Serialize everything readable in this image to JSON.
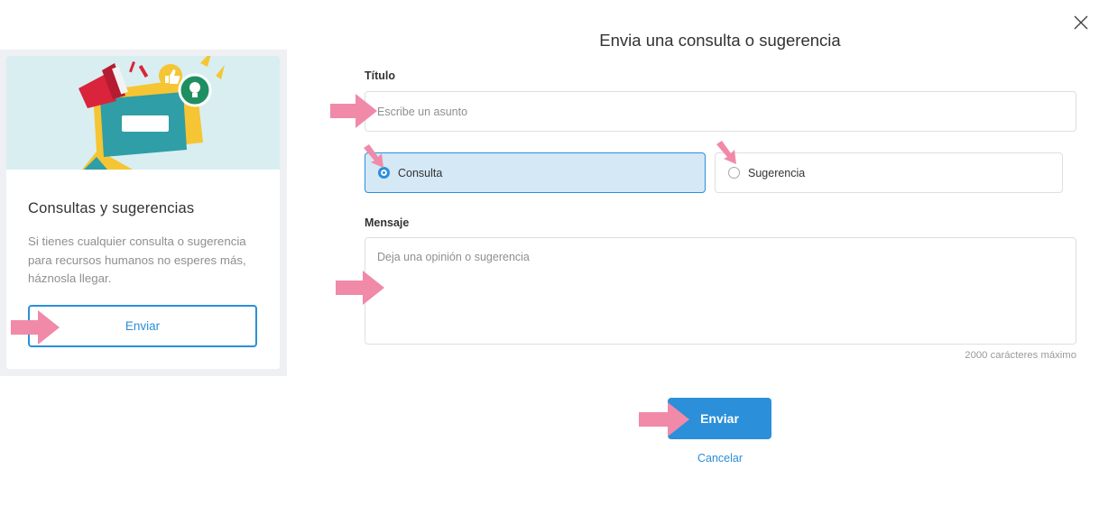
{
  "card": {
    "title": "Consultas y sugerencias",
    "description": "Si tienes cualquier consulta o sugerencia para recursos humanos no esperes más, háznosla llegar.",
    "button_label": "Enviar"
  },
  "modal": {
    "title": "Envia una consulta o sugerencia",
    "title_label": "Título",
    "title_placeholder": "Escribe un asunto",
    "type_options": [
      {
        "label": "Consulta",
        "selected": true
      },
      {
        "label": "Sugerencia",
        "selected": false
      }
    ],
    "message_label": "Mensaje",
    "message_placeholder": "Deja una opinión o sugerencia",
    "char_limit_hint": "2000 carácteres máximo",
    "submit_label": "Enviar",
    "cancel_label": "Cancelar"
  },
  "icons": [
    "close-icon",
    "megaphone-icon",
    "thumbs-up-icon",
    "lightbulb-icon",
    "speech-bubble-icon",
    "pointer-arrow-icon"
  ],
  "colors": {
    "accent": "#2b8fd9",
    "selected_bg": "#d5e8f6",
    "annotation_arrow": "#f08aa8",
    "illustration_bg": "#d9eef0"
  }
}
